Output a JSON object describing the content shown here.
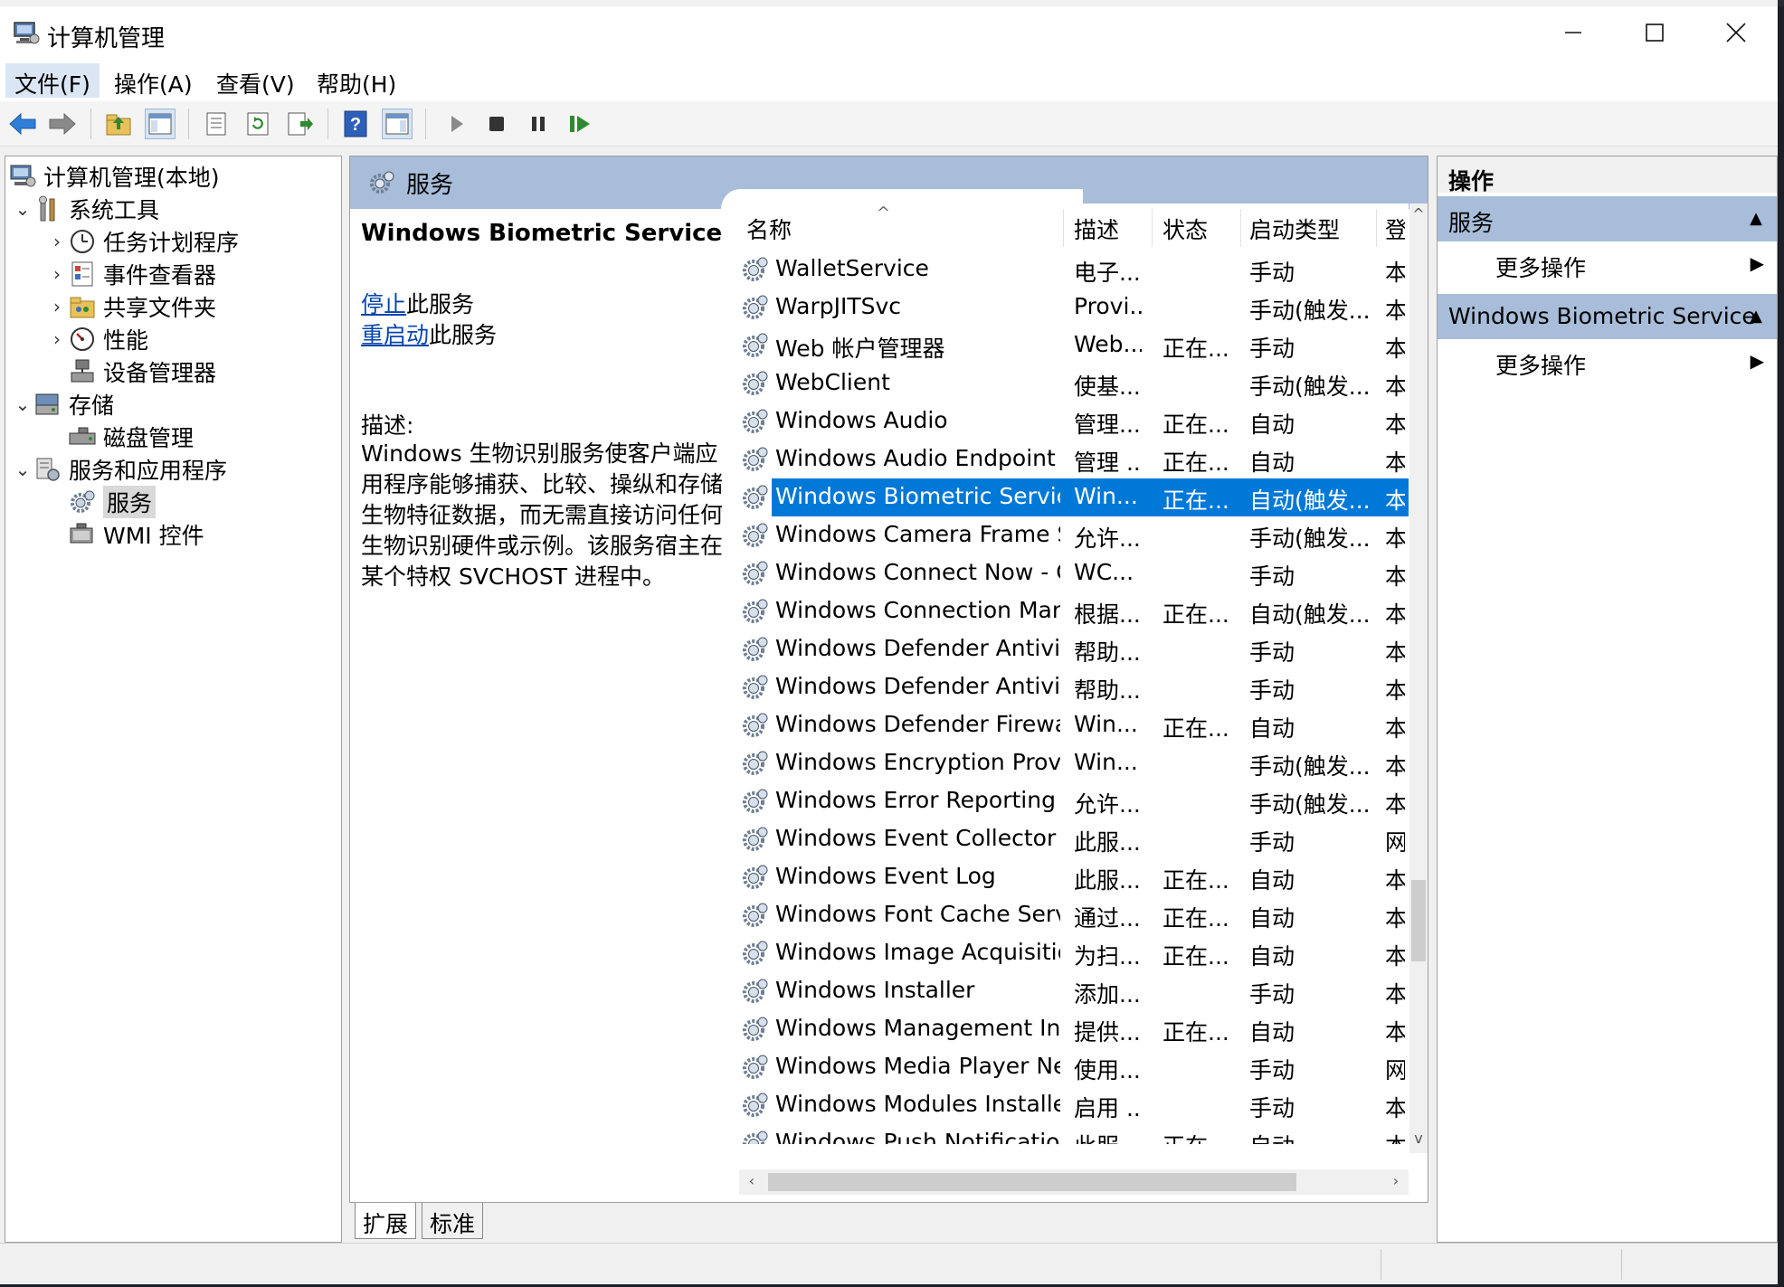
{
  "window": {
    "title": "计算机管理"
  },
  "menu": [
    {
      "label": "文件(F)"
    },
    {
      "label": "操作(A)"
    },
    {
      "label": "查看(V)"
    },
    {
      "label": "帮助(H)"
    }
  ],
  "tree": {
    "root": "计算机管理(本地)",
    "system_tools": "系统工具",
    "task_scheduler": "任务计划程序",
    "event_viewer": "事件查看器",
    "shared_folders": "共享文件夹",
    "performance": "性能",
    "device_manager": "设备管理器",
    "storage": "存储",
    "disk_management": "磁盘管理",
    "services_apps": "服务和应用程序",
    "services": "服务",
    "wmi": "WMI 控件"
  },
  "center": {
    "header": "服务",
    "selected_service": "Windows Biometric Service",
    "stop_link": "停止",
    "stop_suffix": "此服务",
    "restart_link": "重启动",
    "restart_suffix": "此服务",
    "desc_label": "描述:",
    "desc_text": "Windows 生物识别服务使客户端应用程序能够捕获、比较、操纵和存储生物特征数据，而无需直接访问任何生物识别硬件或示例。该服务宿主在某个特权 SVCHOST 进程中。"
  },
  "columns": {
    "name": "名称",
    "desc": "描述",
    "state": "状态",
    "startup": "启动类型",
    "login": "登"
  },
  "services": [
    {
      "name": "WalletService",
      "desc": "电子...",
      "state": "",
      "startup": "手动",
      "login": "本"
    },
    {
      "name": "WarpJITSvc",
      "desc": "Provi...",
      "state": "",
      "startup": "手动(触发...",
      "login": "本"
    },
    {
      "name": "Web 帐户管理器",
      "desc": "Web...",
      "state": "正在...",
      "startup": "手动",
      "login": "本"
    },
    {
      "name": "WebClient",
      "desc": "使基...",
      "state": "",
      "startup": "手动(触发...",
      "login": "本"
    },
    {
      "name": "Windows Audio",
      "desc": "管理...",
      "state": "正在...",
      "startup": "自动",
      "login": "本"
    },
    {
      "name": "Windows Audio Endpoint B...",
      "desc": "管理 ...",
      "state": "正在...",
      "startup": "自动",
      "login": "本"
    },
    {
      "name": "Windows Biometric Service",
      "desc": "Win...",
      "state": "正在...",
      "startup": "自动(触发...",
      "login": "本",
      "selected": true
    },
    {
      "name": "Windows Camera Frame S...",
      "desc": "允许...",
      "state": "",
      "startup": "手动(触发...",
      "login": "本"
    },
    {
      "name": "Windows Connect Now - C...",
      "desc": "WC...",
      "state": "",
      "startup": "手动",
      "login": "本"
    },
    {
      "name": "Windows Connection Man...",
      "desc": "根据...",
      "state": "正在...",
      "startup": "自动(触发...",
      "login": "本"
    },
    {
      "name": "Windows Defender Antivir...",
      "desc": "帮助...",
      "state": "",
      "startup": "手动",
      "login": "本"
    },
    {
      "name": "Windows Defender Antivir...",
      "desc": "帮助...",
      "state": "",
      "startup": "手动",
      "login": "本"
    },
    {
      "name": "Windows Defender Firewall",
      "desc": "Win...",
      "state": "正在...",
      "startup": "自动",
      "login": "本"
    },
    {
      "name": "Windows Encryption Provid...",
      "desc": "Win...",
      "state": "",
      "startup": "手动(触发...",
      "login": "本"
    },
    {
      "name": "Windows Error Reporting S...",
      "desc": "允许...",
      "state": "",
      "startup": "手动(触发...",
      "login": "本"
    },
    {
      "name": "Windows Event Collector",
      "desc": "此服...",
      "state": "",
      "startup": "手动",
      "login": "网"
    },
    {
      "name": "Windows Event Log",
      "desc": "此服...",
      "state": "正在...",
      "startup": "自动",
      "login": "本"
    },
    {
      "name": "Windows Font Cache Servi...",
      "desc": "通过...",
      "state": "正在...",
      "startup": "自动",
      "login": "本"
    },
    {
      "name": "Windows Image Acquisitio...",
      "desc": "为扫...",
      "state": "正在...",
      "startup": "自动",
      "login": "本"
    },
    {
      "name": "Windows Installer",
      "desc": "添加...",
      "state": "",
      "startup": "手动",
      "login": "本"
    },
    {
      "name": "Windows Management Ins...",
      "desc": "提供...",
      "state": "正在...",
      "startup": "自动",
      "login": "本"
    },
    {
      "name": "Windows Media Player Net...",
      "desc": "使用...",
      "state": "",
      "startup": "手动",
      "login": "网"
    },
    {
      "name": "Windows Modules Installer",
      "desc": "启用 ...",
      "state": "",
      "startup": "手动",
      "login": "本"
    },
    {
      "name": "Windows Push Notification...",
      "desc": "此服...",
      "state": "正在...",
      "startup": "自动",
      "login": "本"
    }
  ],
  "tabs": {
    "extended": "扩展",
    "standard": "标准"
  },
  "actions": {
    "title": "操作",
    "group1": "服务",
    "group1_item": "更多操作",
    "group2": "Windows Biometric Service",
    "group2_item": "更多操作"
  },
  "colors": {
    "selection": "#0078d7",
    "header_band": "#a7bdd9",
    "link": "#0645ad"
  }
}
